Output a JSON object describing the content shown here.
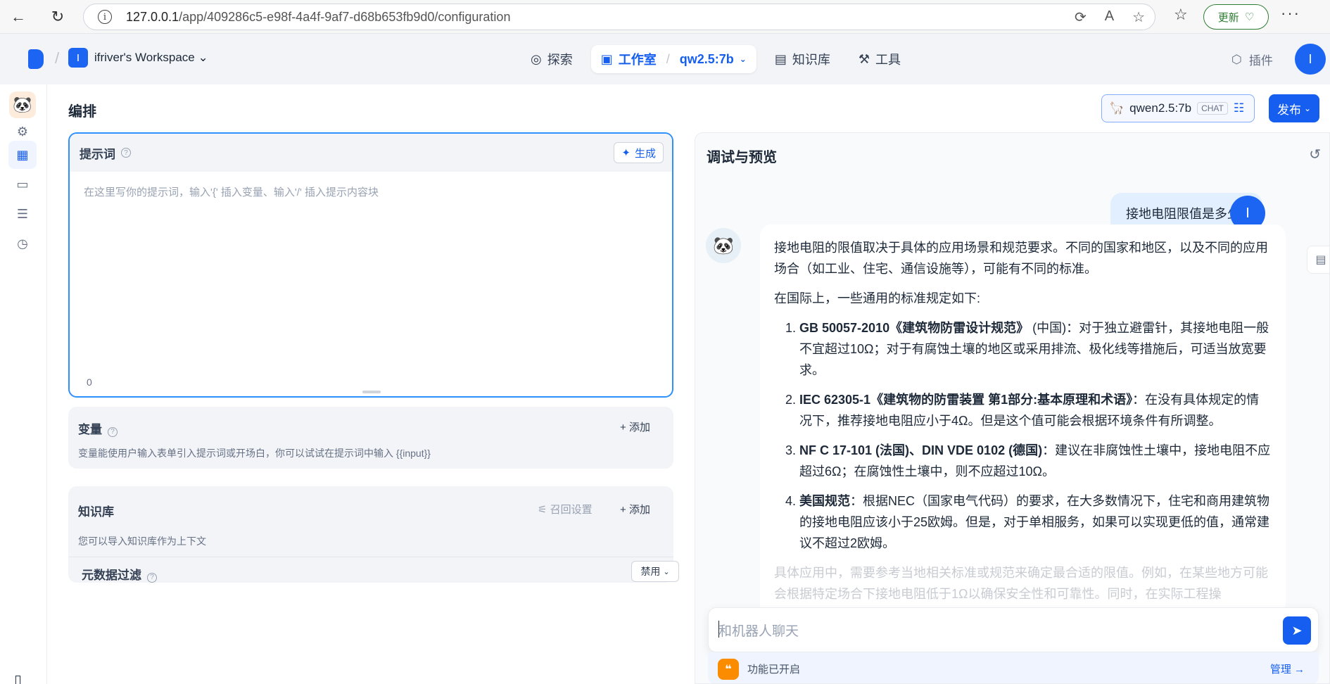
{
  "browser": {
    "url_host": "127.0.0.1",
    "url_path": "/app/409286c5-e98f-4a4f-9af7-d68b653fb9d0/configuration",
    "update_label": "更新"
  },
  "nav": {
    "workspace_initial": "I",
    "workspace_name": "ifriver's Workspace",
    "explore": "探索",
    "studio": "工作室",
    "app_name": "qw2.5:7b",
    "knowledge": "知识库",
    "tools": "工具",
    "plugins": "插件",
    "user_initial": "I"
  },
  "page": {
    "title": "编排",
    "model_name": "qwen2.5:7b",
    "model_tag": "CHAT",
    "publish": "发布"
  },
  "prompt": {
    "title": "提示词",
    "generate": "生成",
    "placeholder": "在这里写你的提示词，输入'{' 插入变量、输入'/' 插入提示内容块",
    "count": "0"
  },
  "variables": {
    "title": "变量",
    "add": "添加",
    "desc": "变量能使用户输入表单引入提示词或开场白，你可以试试在提示词中输入 {{input}}"
  },
  "knowledge": {
    "title": "知识库",
    "recall": "召回设置",
    "add": "添加",
    "desc": "您可以导入知识库作为上下文",
    "filter_title": "元数据过滤",
    "filter_value": "禁用"
  },
  "debug": {
    "title": "调试与预览",
    "user_question": "接地电阻限值是多少?",
    "answer_intro": "接地电阻的限值取决于具体的应用场景和规范要求。不同的国家和地区，以及不同的应用场合（如工业、住宅、通信设施等），可能有不同的标准。",
    "answer_lead": "在国际上，一些通用的标准规定如下:",
    "items": [
      {
        "bold": "GB 50057-2010《建筑物防雷设计规范》",
        "rest": " (中国)：对于独立避雷针，其接地电阻一般不宜超过10Ω；对于有腐蚀土壤的地区或采用排流、极化线等措施后，可适当放宽要求。"
      },
      {
        "bold": "IEC 62305-1《建筑物的防雷装置 第1部分:基本原理和术语》",
        "rest": "：在没有具体规定的情况下，推荐接地电阻应小于4Ω。但是这个值可能会根据环境条件有所调整。"
      },
      {
        "bold": "NF C 17-101 (法国)、DIN VDE 0102 (德国)",
        "rest": "：建议在非腐蚀性土壤中，接地电阻不应超过6Ω；在腐蚀性土壤中，则不应超过10Ω。"
      },
      {
        "bold": "美国规范",
        "rest": "：根据NEC（国家电气代码）的要求，在大多数情况下，住宅和商用建筑物的接地电阻应该小于25欧姆。但是，对于单相服务，如果可以实现更低的值，通常建议不超过2欧姆。"
      }
    ],
    "answer_faded": "具体应用中，需要参考当地相关标准或规范来确定最合适的限值。例如，在某些地方可能会根据特定场合下接地电阻低于1Ω以确保安全性和可靠性。同时，在实际工程操",
    "input_placeholder": "和机器人聊天",
    "feature_text": "功能已开启",
    "manage": "管理"
  },
  "colors": {
    "primary": "#155eef",
    "prompt_border": "#2e90fa",
    "user_bubble": "#e1effe",
    "feature_icon": "#fb8c00"
  }
}
